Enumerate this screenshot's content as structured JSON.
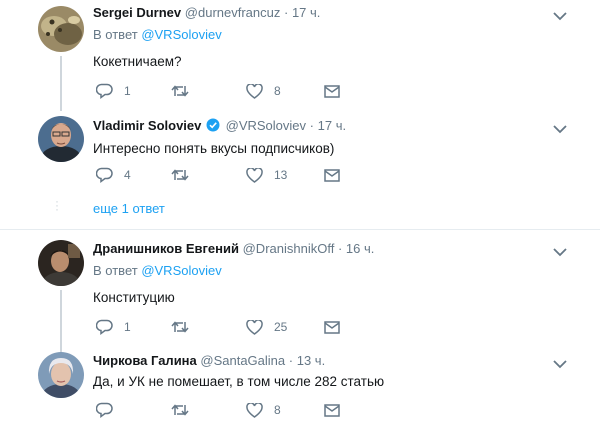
{
  "tweets": [
    {
      "name": "Sergei Durnev",
      "handle": "@durnevfrancuz",
      "dot": "·",
      "time": "17 ч.",
      "reply_prefix": "В ответ ",
      "reply_to": "@VRSoloviev",
      "text": "Кокетничаем?",
      "replies": "1",
      "retweets": "",
      "likes": "8",
      "verified": false
    },
    {
      "name": "Vladimir Soloviev",
      "handle": "@VRSoloviev",
      "dot": "·",
      "time": "17 ч.",
      "reply_prefix": "",
      "reply_to": "",
      "text": "Интересно понять вкусы подписчиков)",
      "replies": "4",
      "retweets": "",
      "likes": "13",
      "verified": true
    },
    {
      "name": "Дранишников Евгений",
      "handle": "@DranishnikOff",
      "dot": "·",
      "time": "16 ч.",
      "reply_prefix": "В ответ ",
      "reply_to": "@VRSoloviev",
      "text": "Конституцию",
      "replies": "1",
      "retweets": "",
      "likes": "25",
      "verified": false
    },
    {
      "name": "Чиркова Галина",
      "handle": "@SantaGalina",
      "dot": "·",
      "time": "13 ч.",
      "reply_prefix": "",
      "reply_to": "",
      "text": "Да, и УК не помешает, в том числе 282 статью",
      "replies": "",
      "retweets": "",
      "likes": "8",
      "verified": false
    }
  ],
  "show_more": "еще 1 ответ",
  "icons": {
    "reply": "reply-icon",
    "retweet": "retweet-icon",
    "like": "heart-icon",
    "message": "envelope-icon",
    "menu": "chevron-down-icon",
    "verified": "verified-badge-icon"
  },
  "colors": {
    "link": "#1da1f2",
    "muted": "#657786",
    "text": "#14171a",
    "verified": "#1da1f2"
  }
}
